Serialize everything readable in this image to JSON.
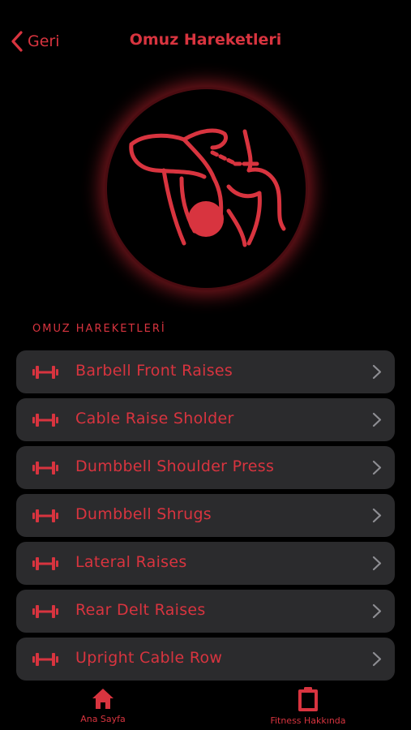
{
  "nav": {
    "back_label": "Geri",
    "title": "Omuz Hareketleri"
  },
  "hero": {
    "icon": "shoulder-muscle-icon"
  },
  "section": {
    "title": "OMUZ HAREKETLERİ"
  },
  "exercises": [
    {
      "label": "Barbell Front Raises",
      "icon": "dumbbell-icon"
    },
    {
      "label": "Cable Raise Sholder",
      "icon": "dumbbell-icon"
    },
    {
      "label": "Dumbbell Shoulder Press",
      "icon": "dumbbell-icon"
    },
    {
      "label": "Dumbbell Shrugs",
      "icon": "dumbbell-icon"
    },
    {
      "label": "Lateral Raises",
      "icon": "dumbbell-icon"
    },
    {
      "label": "Rear Delt Raises",
      "icon": "dumbbell-icon"
    },
    {
      "label": "Upright Cable Row",
      "icon": "dumbbell-icon"
    }
  ],
  "tabbar": {
    "home_label": "Ana Sayfa",
    "about_label": "Fitness Hakkında"
  },
  "colors": {
    "accent": "#d8343f",
    "background": "#000000",
    "row": "#2b2b2d",
    "chevron": "#8e8e93"
  }
}
